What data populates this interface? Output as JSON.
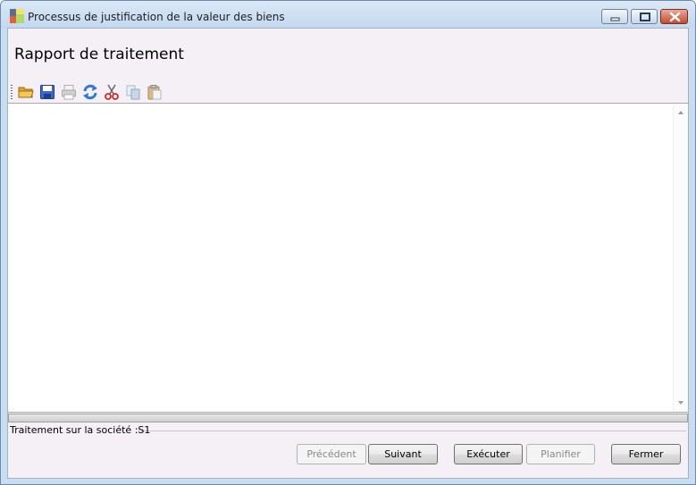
{
  "window": {
    "title": "Processus de justification de la valeur des biens",
    "app_icon": "app-icon"
  },
  "controls": {
    "minimize_icon": "minimize-icon",
    "maximize_icon": "maximize-icon",
    "close_icon": "close-icon"
  },
  "heading": "Rapport de traitement",
  "toolbar": {
    "items": [
      {
        "name": "open-folder-icon",
        "enabled": true
      },
      {
        "name": "save-icon",
        "enabled": true
      },
      {
        "name": "print-icon",
        "enabled": false
      },
      {
        "name": "refresh-icon",
        "enabled": true
      },
      {
        "name": "cut-icon",
        "enabled": true
      },
      {
        "name": "copy-icon",
        "enabled": false
      },
      {
        "name": "paste-icon",
        "enabled": false
      }
    ]
  },
  "report_text": "",
  "status": {
    "text": "Traitement sur la société :S1"
  },
  "buttons": {
    "previous": {
      "label": "Précédent",
      "enabled": false
    },
    "next": {
      "label": "Suivant",
      "enabled": true
    },
    "execute": {
      "label": "Exécuter",
      "enabled": true
    },
    "schedule": {
      "label": "Planifier",
      "enabled": false
    },
    "close": {
      "label": "Fermer",
      "enabled": true
    }
  },
  "colors": {
    "title_bar": "#c3d8ef",
    "client_bg": "#f5f0f5",
    "close_button": "#c34a30"
  }
}
